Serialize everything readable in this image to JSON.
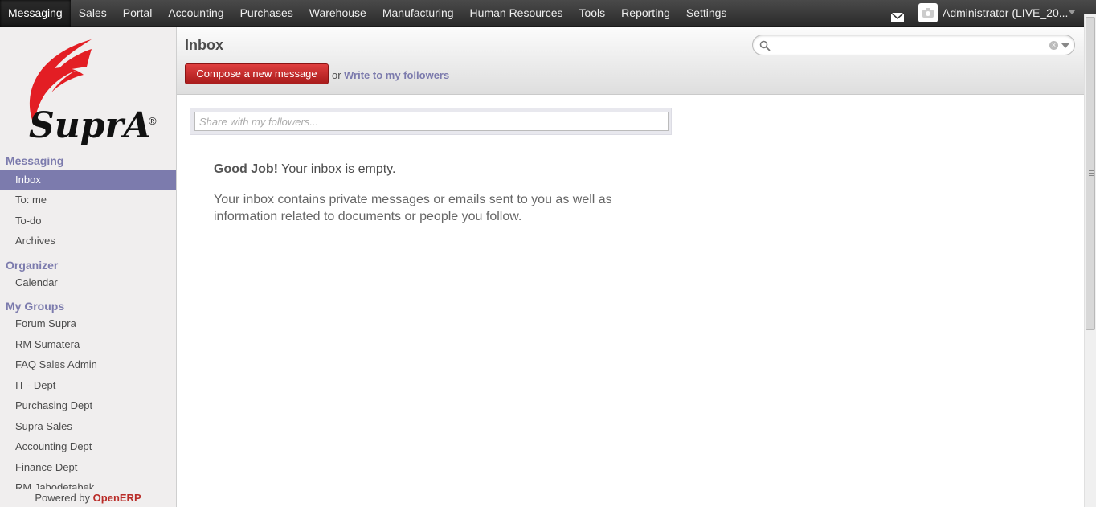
{
  "topbar": {
    "menu": [
      "Messaging",
      "Sales",
      "Portal",
      "Accounting",
      "Purchases",
      "Warehouse",
      "Manufacturing",
      "Human Resources",
      "Tools",
      "Reporting",
      "Settings"
    ],
    "user": "Administrator (LIVE_20..."
  },
  "sidebar": {
    "logo_text": "SuprA",
    "sections": {
      "messaging": {
        "title": "Messaging",
        "items": [
          "Inbox",
          "To: me",
          "To-do",
          "Archives"
        ]
      },
      "organizer": {
        "title": "Organizer",
        "items": [
          "Calendar"
        ]
      },
      "groups": {
        "title": "My Groups",
        "items": [
          "Forum Supra",
          "RM Sumatera",
          "FAQ Sales Admin",
          "IT - Dept",
          "Purchasing Dept",
          "Supra Sales",
          "Accounting Dept",
          "Finance Dept",
          "RM Jabodetabek"
        ]
      }
    },
    "powered_by": "Powered by",
    "powered_brand": "OpenERP"
  },
  "header": {
    "title": "Inbox",
    "compose_label": "Compose a new message",
    "or_text": "or",
    "followers_link": "Write to my followers",
    "search_value": ""
  },
  "content": {
    "share_placeholder": "Share with my followers...",
    "empty_strong": "Good Job!",
    "empty_text": " Your inbox is empty.",
    "empty_desc": "Your inbox contains private messages or emails sent to you as well as information related to documents or people you follow."
  },
  "colors": {
    "accent": "#7c7bad",
    "compose": "#c62828",
    "brand_red": "#e31e24"
  }
}
